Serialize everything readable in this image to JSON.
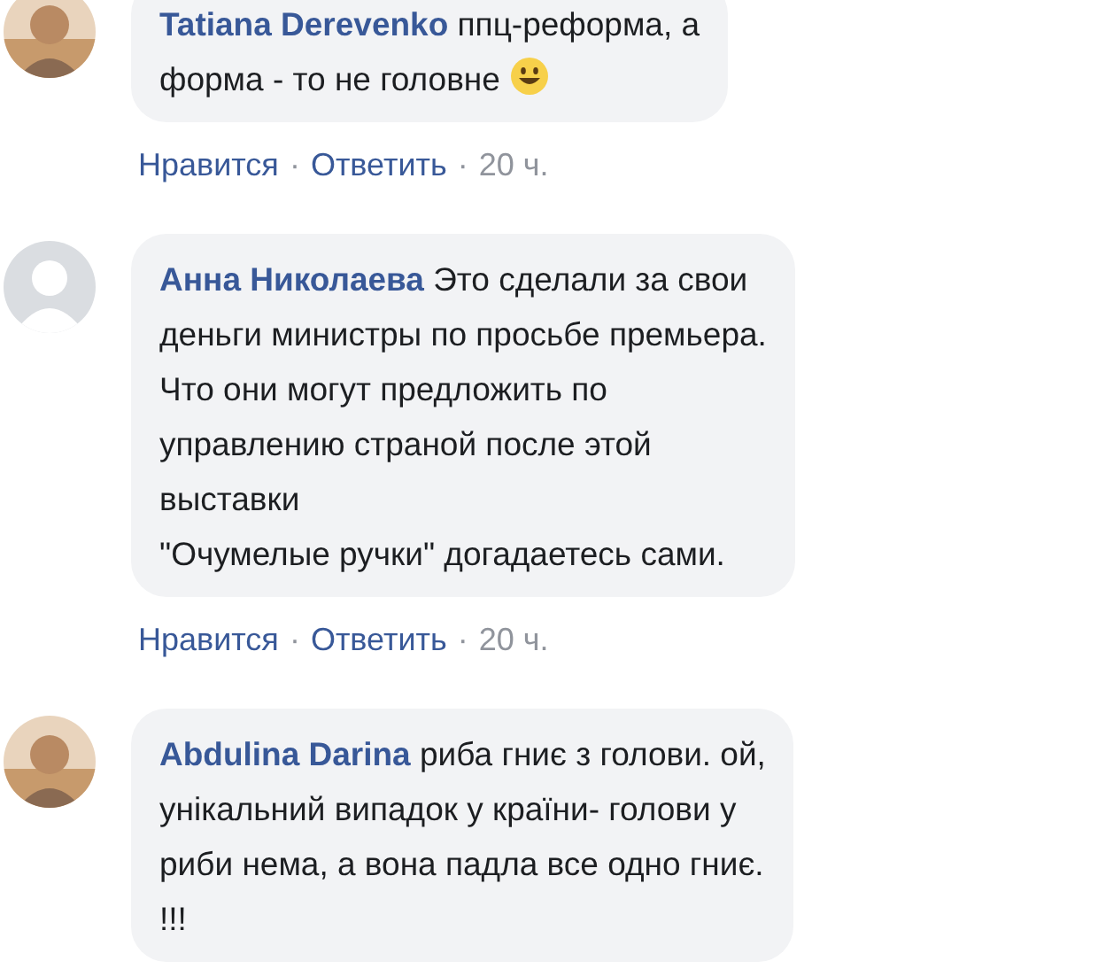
{
  "comments": [
    {
      "avatar": {
        "kind": "photo"
      },
      "author": "Tatiana Derevenko",
      "text": " ппц-реформа, а\nформа - то не головне",
      "emoji": {
        "kind": "smiley"
      },
      "actions": [
        "Нравится",
        "·",
        "Ответить",
        "·"
      ],
      "time": "20 ч."
    },
    {
      "avatar": {
        "kind": "default"
      },
      "author": "Анна Николаева",
      "text": " Это сделали за свои\nденьги министры по просьбе премьера.\nЧто они могут предложить по\nуправлению страной после этой\nвыставки\n\"Очумелые ручки\" догадаетесь сами.",
      "actions": [
        "Нравится",
        "·",
        "Ответить",
        "·"
      ],
      "time": "20 ч."
    },
    {
      "avatar": {
        "kind": "photo"
      },
      "author": "Abdulina Darina",
      "text": " риба гниє з голови. ой,\nунікальний випадок у країни- голови у\nриби нема, а вона падла все одно гниє.\n!!!"
    }
  ]
}
